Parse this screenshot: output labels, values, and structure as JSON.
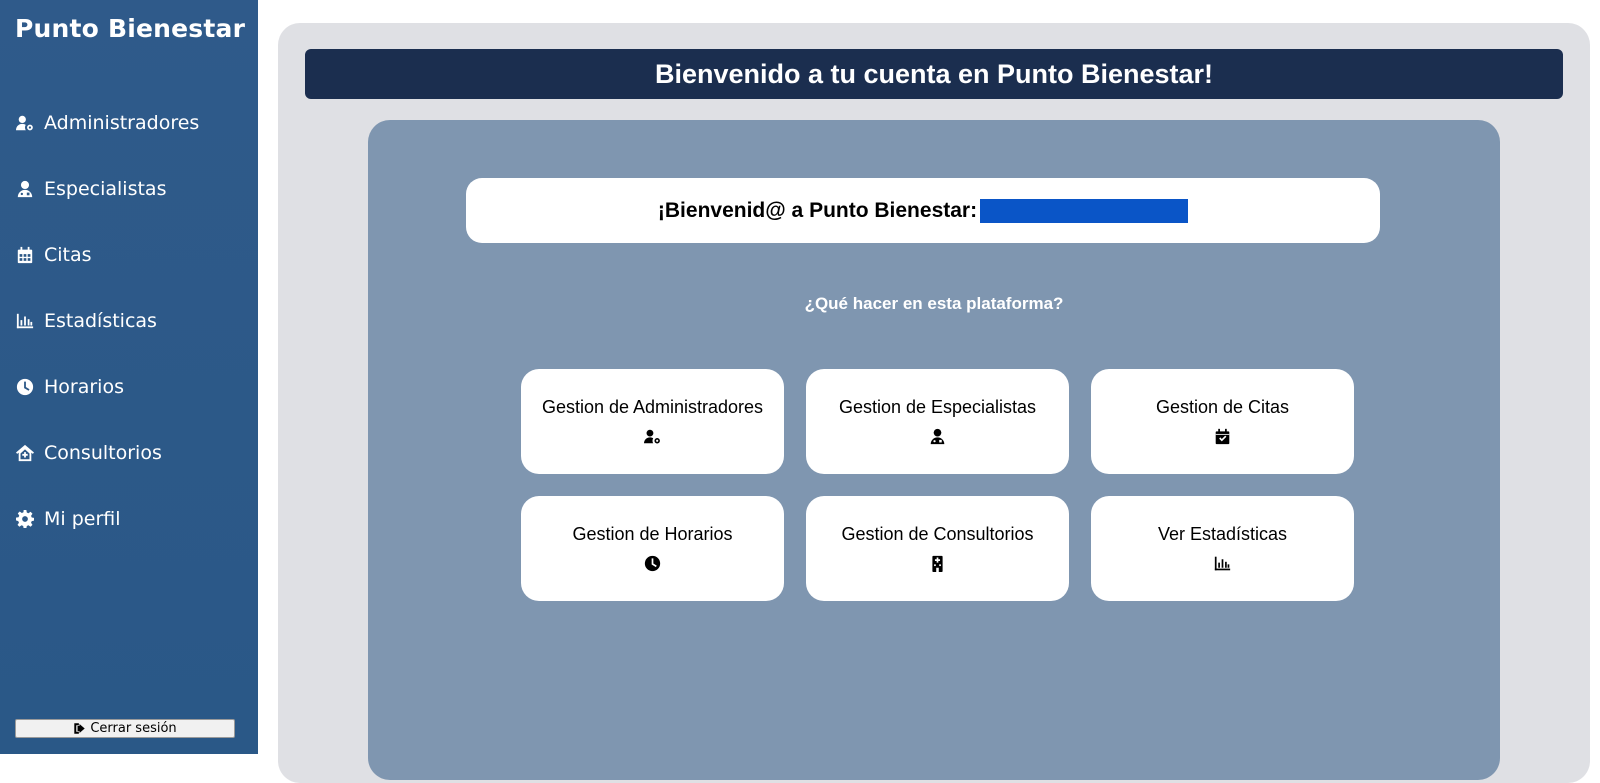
{
  "sidebar": {
    "brand": "Punto Bienestar",
    "items": [
      {
        "label": "Administradores",
        "icon": "user-gear-icon"
      },
      {
        "label": "Especialistas",
        "icon": "user-doctor-icon"
      },
      {
        "label": "Citas",
        "icon": "calendar-icon"
      },
      {
        "label": "Estadísticas",
        "icon": "bar-chart-icon"
      },
      {
        "label": "Horarios",
        "icon": "clock-icon"
      },
      {
        "label": "Consultorios",
        "icon": "house-medical-icon"
      },
      {
        "label": "Mi perfil",
        "icon": "gear-icon"
      }
    ],
    "logout_label": "Cerrar sesión"
  },
  "header": {
    "title": "Bienvenido a tu cuenta en Punto Bienestar!"
  },
  "main": {
    "welcome_text": "¡Bienvenid@ a Punto Bienestar:",
    "question": "¿Qué hacer en esta plataforma?",
    "cards": [
      {
        "label": "Gestion de Administradores",
        "icon": "user-gear-icon"
      },
      {
        "label": "Gestion de Especialistas",
        "icon": "user-doctor-icon"
      },
      {
        "label": "Gestion de Citas",
        "icon": "calendar-check-icon"
      },
      {
        "label": "Gestion de Horarios",
        "icon": "clock-icon"
      },
      {
        "label": "Gestion de Consultorios",
        "icon": "hospital-icon"
      },
      {
        "label": "Ver Estadísticas",
        "icon": "bar-chart-icon"
      }
    ]
  },
  "colors": {
    "sidebar": "#2c5887",
    "header_bar": "#1b2e4f",
    "content_panel": "#7f96b0",
    "redaction": "#0a55c7"
  }
}
